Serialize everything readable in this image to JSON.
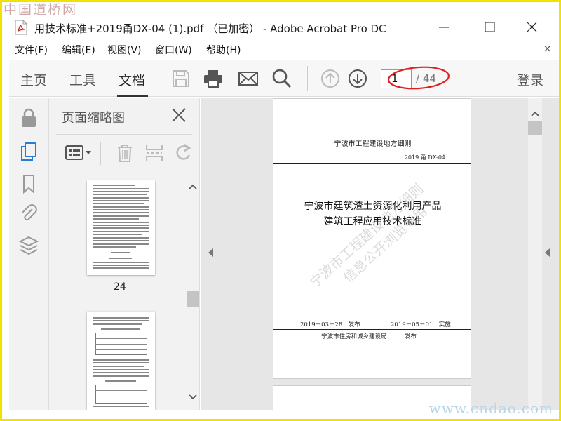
{
  "watermark": {
    "site_top": "中国道桥网",
    "site_bottom": "www.cndao.com"
  },
  "window": {
    "title": "用技术标准+2019甬DX-04 (1).pdf （已加密） - Adobe Acrobat Pro DC"
  },
  "menu": {
    "items": [
      "文件(F)",
      "编辑(E)",
      "视图(V)",
      "窗口(W)",
      "帮助(H)"
    ],
    "close": "×"
  },
  "toolbar": {
    "tabs": [
      "主页",
      "工具",
      "文档"
    ],
    "active_tab": "文档",
    "page_current": "1",
    "page_total": "/ 44",
    "login": "登录"
  },
  "thumbnail_panel": {
    "title": "页面缩略图",
    "visible_page_label": "24"
  },
  "document": {
    "header": "宁波市工程建设地方细则",
    "std_number": "2019 甬 DX-04",
    "title_line1": "宁波市建筑渣土资源化利用产品",
    "title_line2": "建筑工程应用技术标准",
    "watermark_line1": "宁波市工程建设地方细则",
    "watermark_line2": "信息公开浏览专用",
    "publish_date": "2019－03－28　发布",
    "effective_date": "2019－05－01　实施",
    "issuer": "宁波市住房和城乡建设局　　　发布"
  },
  "colors": {
    "frame_border": "#f2e200",
    "annotation": "#e02020",
    "pdf_red": "#d9261c"
  }
}
